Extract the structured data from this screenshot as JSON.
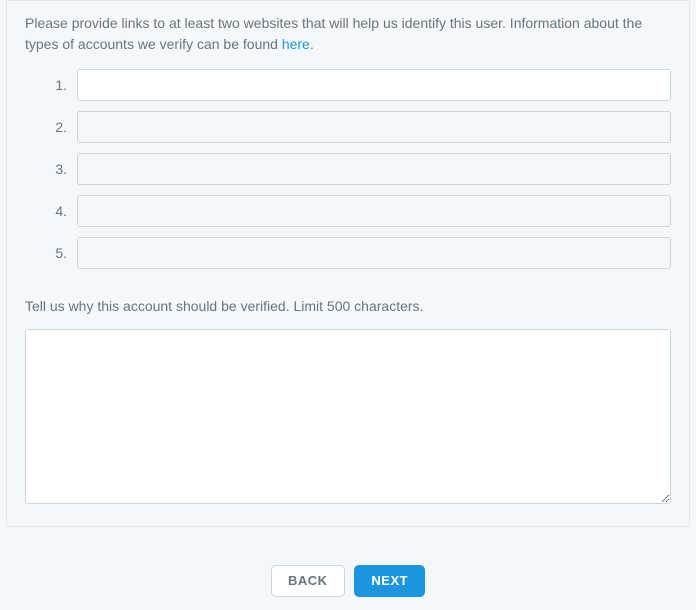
{
  "instruction": {
    "prefix": "Please provide links to at least two websites that will help us identify this user. Information about the types of accounts we verify can be found ",
    "link_label": "here",
    "suffix": "."
  },
  "link_inputs": [
    {
      "num": "1.",
      "value": "",
      "active": true
    },
    {
      "num": "2.",
      "value": "",
      "active": false
    },
    {
      "num": "3.",
      "value": "",
      "active": false
    },
    {
      "num": "4.",
      "value": "",
      "active": false
    },
    {
      "num": "5.",
      "value": "",
      "active": false
    }
  ],
  "reason": {
    "label": "Tell us why this account should be verified. Limit 500 characters.",
    "value": "",
    "maxlength": 500
  },
  "buttons": {
    "back": "BACK",
    "next": "NEXT"
  }
}
